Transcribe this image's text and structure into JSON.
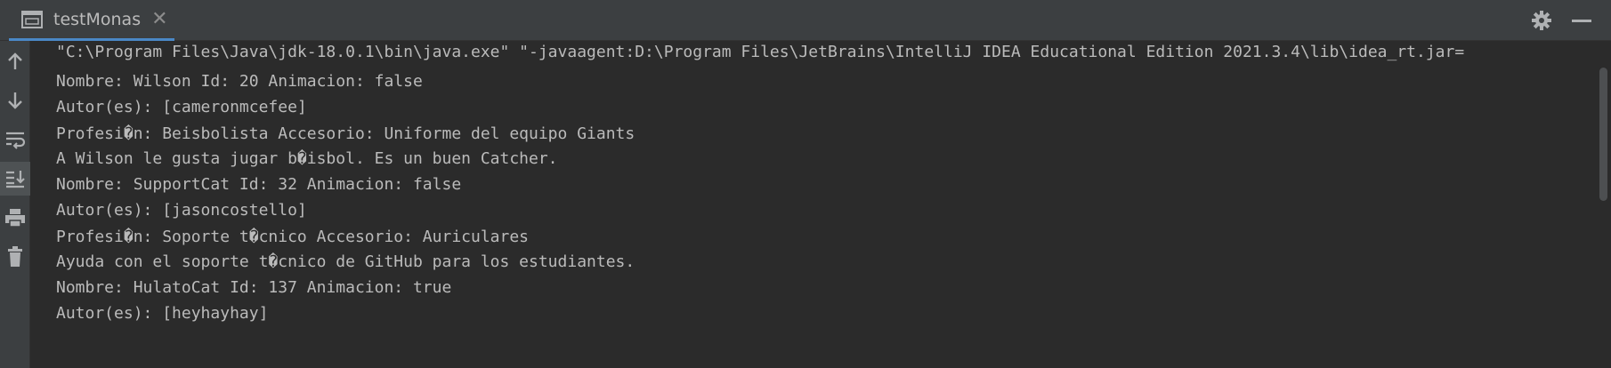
{
  "tab": {
    "label": "testMonas"
  },
  "console": {
    "lines": [
      "\"C:\\Program Files\\Java\\jdk-18.0.1\\bin\\java.exe\" \"-javaagent:D:\\Program Files\\JetBrains\\IntelliJ IDEA Educational Edition 2021.3.4\\lib\\idea_rt.jar=",
      "Nombre: Wilson Id: 20 Animacion: false",
      "Autor(es): [cameronmcefee]",
      "Profesi�n: Beisbolista Accesorio: Uniforme del equipo Giants",
      "A Wilson le gusta jugar b�isbol. Es un buen Catcher.",
      "Nombre: SupportCat Id: 32 Animacion: false",
      "Autor(es): [jasoncostello]",
      "Profesi�n: Soporte t�cnico Accesorio: Auriculares",
      "Ayuda con el soporte t�cnico de GitHub para los estudiantes.",
      "Nombre: HulatoCat Id: 137 Animacion: true",
      "Autor(es): [heyhayhay]"
    ]
  },
  "colors": {
    "background": "#2b2b2b",
    "toolbar": "#3c3f41",
    "text": "#bbbbbb",
    "accent": "#4a88c7"
  }
}
